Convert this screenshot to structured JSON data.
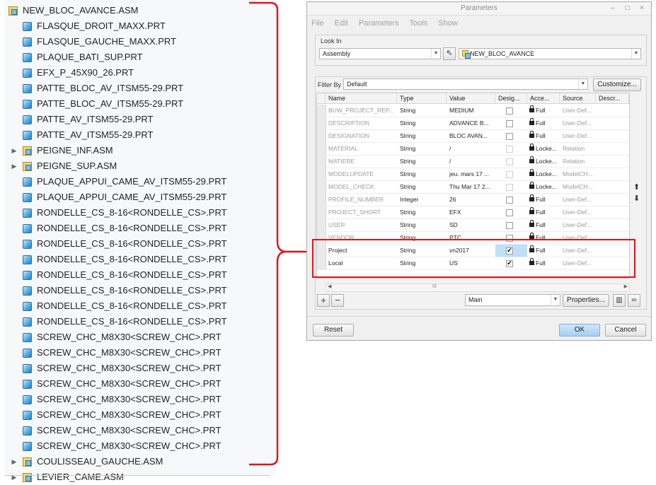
{
  "tree": {
    "items": [
      {
        "label": "NEW_BLOC_AVANCE.ASM",
        "type": "asm",
        "level": 0,
        "expander": ""
      },
      {
        "label": "FLASQUE_DROIT_MAXX.PRT",
        "type": "part",
        "level": 1,
        "expander": ""
      },
      {
        "label": "FLASQUE_GAUCHE_MAXX.PRT",
        "type": "part",
        "level": 1,
        "expander": ""
      },
      {
        "label": "PLAQUE_BATI_SUP.PRT",
        "type": "part",
        "level": 1,
        "expander": ""
      },
      {
        "label": "EFX_P_45X90_26.PRT",
        "type": "part",
        "level": 1,
        "expander": ""
      },
      {
        "label": "PATTE_BLOC_AV_ITSM55-29.PRT",
        "type": "part",
        "level": 1,
        "expander": ""
      },
      {
        "label": "PATTE_BLOC_AV_ITSM55-29.PRT",
        "type": "part",
        "level": 1,
        "expander": ""
      },
      {
        "label": "PATTE_AV_ITSM55-29.PRT",
        "type": "part",
        "level": 1,
        "expander": ""
      },
      {
        "label": "PATTE_AV_ITSM55-29.PRT",
        "type": "part",
        "level": 1,
        "expander": ""
      },
      {
        "label": "PEIGNE_INF.ASM",
        "type": "asm",
        "level": 1,
        "expander": "▶"
      },
      {
        "label": "PEIGNE_SUP.ASM",
        "type": "asm",
        "level": 1,
        "expander": "▶"
      },
      {
        "label": "PLAQUE_APPUI_CAME_AV_ITSM55-29.PRT",
        "type": "part",
        "level": 1,
        "expander": ""
      },
      {
        "label": "PLAQUE_APPUI_CAME_AV_ITSM55-29.PRT",
        "type": "part",
        "level": 1,
        "expander": ""
      },
      {
        "label": "RONDELLE_CS_8-16<RONDELLE_CS>.PRT",
        "type": "part",
        "level": 1,
        "expander": ""
      },
      {
        "label": "RONDELLE_CS_8-16<RONDELLE_CS>.PRT",
        "type": "part",
        "level": 1,
        "expander": ""
      },
      {
        "label": "RONDELLE_CS_8-16<RONDELLE_CS>.PRT",
        "type": "part",
        "level": 1,
        "expander": ""
      },
      {
        "label": "RONDELLE_CS_8-16<RONDELLE_CS>.PRT",
        "type": "part",
        "level": 1,
        "expander": ""
      },
      {
        "label": "RONDELLE_CS_8-16<RONDELLE_CS>.PRT",
        "type": "part",
        "level": 1,
        "expander": ""
      },
      {
        "label": "RONDELLE_CS_8-16<RONDELLE_CS>.PRT",
        "type": "part",
        "level": 1,
        "expander": ""
      },
      {
        "label": "RONDELLE_CS_8-16<RONDELLE_CS>.PRT",
        "type": "part",
        "level": 1,
        "expander": ""
      },
      {
        "label": "RONDELLE_CS_8-16<RONDELLE_CS>.PRT",
        "type": "part",
        "level": 1,
        "expander": ""
      },
      {
        "label": "SCREW_CHC_M8X30<SCREW_CHC>.PRT",
        "type": "part",
        "level": 1,
        "expander": ""
      },
      {
        "label": "SCREW_CHC_M8X30<SCREW_CHC>.PRT",
        "type": "part",
        "level": 1,
        "expander": ""
      },
      {
        "label": "SCREW_CHC_M8X30<SCREW_CHC>.PRT",
        "type": "part",
        "level": 1,
        "expander": ""
      },
      {
        "label": "SCREW_CHC_M8X30<SCREW_CHC>.PRT",
        "type": "part",
        "level": 1,
        "expander": ""
      },
      {
        "label": "SCREW_CHC_M8X30<SCREW_CHC>.PRT",
        "type": "part",
        "level": 1,
        "expander": ""
      },
      {
        "label": "SCREW_CHC_M8X30<SCREW_CHC>.PRT",
        "type": "part",
        "level": 1,
        "expander": ""
      },
      {
        "label": "SCREW_CHC_M8X30<SCREW_CHC>.PRT",
        "type": "part",
        "level": 1,
        "expander": ""
      },
      {
        "label": "SCREW_CHC_M8X30<SCREW_CHC>.PRT",
        "type": "part",
        "level": 1,
        "expander": ""
      },
      {
        "label": "COULISSEAU_GAUCHE.ASM",
        "type": "asm",
        "level": 1,
        "expander": "▶"
      },
      {
        "label": "LEVIER_CAME.ASM",
        "type": "asm",
        "level": 1,
        "expander": "▶"
      }
    ]
  },
  "dialog": {
    "title": "Parameters",
    "window_buttons": "– □ ×",
    "menu": [
      "File",
      "Edit",
      "Parameters",
      "Tools",
      "Show"
    ],
    "look_in_label": "Look In",
    "look_in_type": "Assembly",
    "look_in_object": "NEW_BLOC_AVANCE",
    "filter_label": "Filter By",
    "filter_value": "Default",
    "customize_label": "Customize...",
    "columns": [
      "Name",
      "Type",
      "Value",
      "Desig...",
      "Acce...",
      "Source",
      "Descr..."
    ],
    "rows": [
      {
        "name": "BUW_PROJECT_REP...",
        "type": "String",
        "value": "MEDIUM",
        "desig": false,
        "access": "Full",
        "source": "User-Def...",
        "dim": true,
        "locked": false
      },
      {
        "name": "DESCRIPTION",
        "type": "String",
        "value": "ADVANCE B...",
        "desig": false,
        "access": "Full",
        "source": "User-Def...",
        "dim": true,
        "locked": false
      },
      {
        "name": "DESIGNATION",
        "type": "String",
        "value": "BLOC AVAN...",
        "desig": false,
        "access": "Full",
        "source": "User-Def...",
        "dim": true,
        "locked": false
      },
      {
        "name": "MATERIAL",
        "type": "String",
        "value": "/",
        "desig": false,
        "access": "Locke...",
        "source": "Relation",
        "dim": true,
        "locked": true
      },
      {
        "name": "MATIERE",
        "type": "String",
        "value": "/",
        "desig": false,
        "access": "Locke...",
        "source": "Relation",
        "dim": true,
        "locked": true
      },
      {
        "name": "MODELUPDATE",
        "type": "String",
        "value": "jeu. mars 17 ...",
        "desig": false,
        "access": "Locke...",
        "source": "ModelCH...",
        "dim": true,
        "locked": true
      },
      {
        "name": "MODEL_CHECK",
        "type": "String",
        "value": "Thu Mar 17 2...",
        "desig": false,
        "access": "Locke...",
        "source": "ModelCH...",
        "dim": true,
        "locked": true
      },
      {
        "name": "PROFILE_NUMBER",
        "type": "Integer",
        "value": "26",
        "desig": false,
        "access": "Full",
        "source": "User-Def...",
        "dim": true,
        "locked": false
      },
      {
        "name": "PROJECT_SHORT",
        "type": "String",
        "value": "EFX",
        "desig": false,
        "access": "Full",
        "source": "User-Def...",
        "dim": true,
        "locked": false
      },
      {
        "name": "USER",
        "type": "String",
        "value": "SD",
        "desig": false,
        "access": "Full",
        "source": "User-Def...",
        "dim": true,
        "locked": false
      },
      {
        "name": "VENDOR",
        "type": "String",
        "value": "PTC",
        "desig": false,
        "access": "Full",
        "source": "User-Def...",
        "dim": true,
        "locked": false
      },
      {
        "name": "Project",
        "type": "String",
        "value": "vn2017",
        "desig": true,
        "access": "Full",
        "source": "User-Def...",
        "dim": false,
        "locked": false,
        "selected": true
      },
      {
        "name": "Local",
        "type": "String",
        "value": "US",
        "desig": true,
        "access": "Full",
        "source": "User-Def...",
        "dim": false,
        "locked": false
      }
    ],
    "add_icon": "+",
    "remove_icon": "−",
    "main_value": "Main",
    "properties_label": "Properties...",
    "reset_label": "Reset",
    "ok_label": "OK",
    "cancel_label": "Cancel",
    "up_arrow": "⬆",
    "down_arrow": "⬇",
    "scroll_grip": "III"
  },
  "colors": {
    "annotation": "#e0131b",
    "selected_cell": "#bde0f7",
    "ok_button": "#a6d0f2"
  }
}
